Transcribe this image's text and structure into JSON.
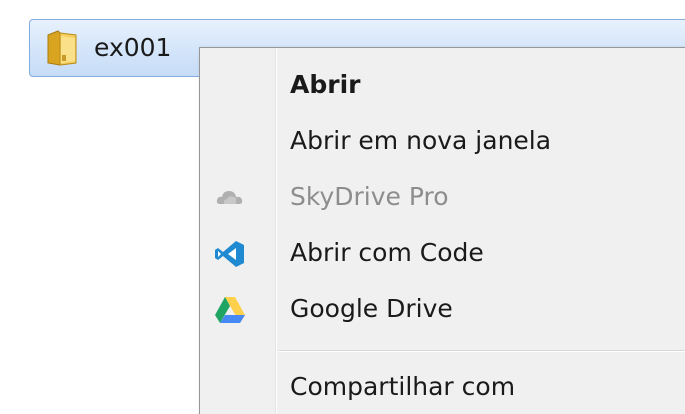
{
  "folder": {
    "name": "ex001",
    "icon": "folder-icon"
  },
  "context_menu": {
    "items": [
      {
        "label": "Abrir",
        "icon": "",
        "default": true,
        "enabled": true
      },
      {
        "label": "Abrir em nova janela",
        "icon": "",
        "default": false,
        "enabled": true
      },
      {
        "label": "SkyDrive Pro",
        "icon": "cloud-icon",
        "default": false,
        "enabled": false
      },
      {
        "label": "Abrir com Code",
        "icon": "vscode-icon",
        "default": false,
        "enabled": true
      },
      {
        "label": "Google Drive",
        "icon": "google-drive-icon",
        "default": false,
        "enabled": true
      },
      {
        "label": "Compartilhar com",
        "icon": "",
        "default": false,
        "enabled": true
      }
    ]
  },
  "colors": {
    "selection_border": "#84acdd",
    "menu_background": "#f0f0f0",
    "disabled_text": "#8d8d8d",
    "vscode_blue": "#1f8ad2",
    "drive_green": "#1fa463",
    "drive_yellow": "#ffd04b",
    "drive_blue": "#4688f4"
  }
}
